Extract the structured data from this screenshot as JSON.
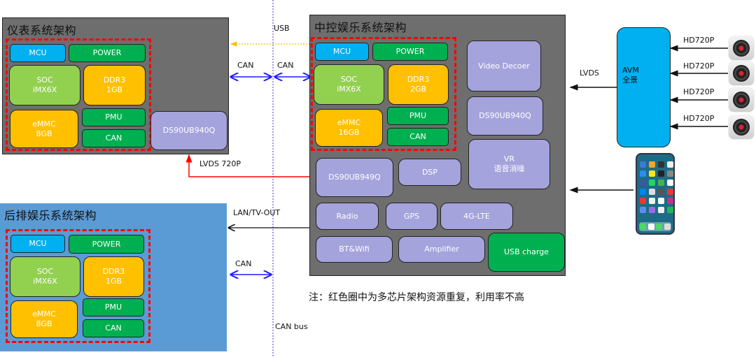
{
  "diagram": {
    "cluster": {
      "title": "仪表系统架构",
      "blocks": {
        "mcu": "MCU",
        "power": "POWER",
        "soc_line1": "SOC",
        "soc_line2": "iMX6X",
        "ddr_line1": "DDR3",
        "ddr_line2": "1GB",
        "emmc_line1": "eMMC",
        "emmc_line2": "8GB",
        "pmu": "PMU",
        "can": "CAN",
        "serdes": "DS90UB940Q"
      }
    },
    "head_unit": {
      "title": "中控娱乐系统架构",
      "blocks": {
        "mcu": "MCU",
        "power": "POWER",
        "soc_line1": "SOC",
        "soc_line2": "iMX6X",
        "ddr_line1": "DDR3",
        "ddr_line2": "2GB",
        "emmc_line1": "eMMC",
        "emmc_line2": "16GB",
        "pmu": "PMU",
        "can": "CAN",
        "video_decoder": "Video Decoer",
        "deserializer": "DS90UB940Q",
        "vr_line1": "VR",
        "vr_line2": "语音消噪",
        "serializer": "DS90UB949Q",
        "dsp": "DSP",
        "radio": "Radio",
        "gps": "GPS",
        "lte": "4G-LTE",
        "bt_wifi": "BT&Wifi",
        "amplifier": "Amplifier",
        "usb_charge": "USB charge"
      }
    },
    "rear": {
      "title": "后排娱乐系统架构",
      "blocks": {
        "mcu": "MCU",
        "power": "POWER",
        "soc_line1": "SOC",
        "soc_line2": "iMX6X",
        "ddr_line1": "DDR3",
        "ddr_line2": "1GB",
        "emmc_line1": "eMMC",
        "emmc_line2": "8GB",
        "pmu": "PMU",
        "can": "CAN"
      }
    },
    "avm": {
      "line1": "AVM",
      "line2": "全景"
    },
    "links": {
      "usb": "USB",
      "can_left": "CAN",
      "can_right": "CAN",
      "lvds_720p": "LVDS 720P",
      "lan_tv_out": "LAN/TV-OUT",
      "can_rear": "CAN",
      "lvds": "LVDS",
      "can_bus": "CAN bus",
      "hd_inputs": [
        "HD720P",
        "HD720P",
        "HD720P",
        "HD720P"
      ]
    },
    "note": "注：红色圈中为多芯片架构资源重复，利用率不高",
    "colors": {
      "panel": "#6e6e6e",
      "rear_panel": "#5b9bd5",
      "mcu": "#00b0f0",
      "green": "#00b050",
      "soc": "#92d050",
      "memory": "#ffc000",
      "peripheral": "#a5a3dc",
      "redundancy_outline": "#ff0000",
      "can_arrow": "#0000ff",
      "usb_arrow": "#ffc000",
      "lvds_arrow": "#ff0000"
    }
  }
}
